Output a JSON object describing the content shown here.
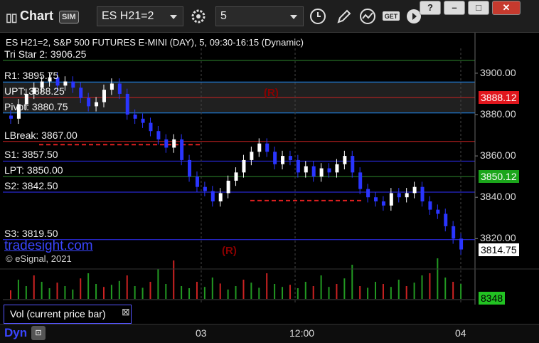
{
  "toolbar": {
    "title": "Chart",
    "sim_badge": "SIM",
    "symbol": "ES H21=2",
    "interval": "5"
  },
  "window": {
    "help_label": "?",
    "minimize_label": "–",
    "maximize_label": "□",
    "close_label": "✕"
  },
  "chart": {
    "header": "ES H21=2, S&P 500 FUTURES E-MINI (DAY), 5, 09:30-16:15 (Dynamic)",
    "watermark": "tradesight.com",
    "copyright": "© eSignal, 2021",
    "r_marks": [
      "(R)",
      "(R)"
    ],
    "levels": [
      {
        "label": "Tri Star 2: 3906.25",
        "value": 3906.25,
        "color": "#2e8b2e"
      },
      {
        "label": "R1: 3895.75",
        "value": 3895.75,
        "color": "#1e90ff"
      },
      {
        "label": "UPT: 3888.25",
        "value": 3888.25,
        "color": "#cc2222"
      },
      {
        "label": "Pivot: 3880.75",
        "value": 3880.75,
        "color": "#1e90ff"
      },
      {
        "label": "LBreak: 3867.00",
        "value": 3867.0,
        "color": "#cc2222"
      },
      {
        "label": "S1: 3857.50",
        "value": 3857.5,
        "color": "#3030ff"
      },
      {
        "label": "LPT: 3850.00",
        "value": 3850.0,
        "color": "#2e8b2e"
      },
      {
        "label": "S2: 3842.50",
        "value": 3842.5,
        "color": "#3030ff"
      },
      {
        "label": "S3: 3819.50",
        "value": 3819.5,
        "color": "#3030ff"
      }
    ],
    "price_axis": [
      "3900.00",
      "3880.00",
      "3860.00",
      "3840.00",
      "3820.00"
    ],
    "price_tags": {
      "upt": "3888.12",
      "lpt": "3850.12",
      "last": "3814.75",
      "volume": "8348"
    },
    "time_axis": [
      "03",
      "12:00",
      "04"
    ],
    "colors": {
      "up": "#ffffff",
      "down": "#2a35ff",
      "upt_tag": "#e0161d",
      "lpt_tag": "#1ba51b"
    }
  },
  "chart_data": {
    "type": "candlestick",
    "symbol": "ES H21=2",
    "y_range": [
      3806,
      3912
    ],
    "closes": [
      3878,
      3885,
      3890,
      3893,
      3896,
      3898,
      3894,
      3896,
      3893,
      3888,
      3884,
      3886,
      3892,
      3895,
      3890,
      3880,
      3878,
      3876,
      3872,
      3868,
      3864,
      3868,
      3858,
      3850,
      3845,
      3843,
      3838,
      3842,
      3848,
      3852,
      3858,
      3862,
      3866,
      3862,
      3856,
      3860,
      3858,
      3852,
      3855,
      3850,
      3854,
      3852,
      3856,
      3860,
      3852,
      3844,
      3840,
      3838,
      3836,
      3842,
      3840,
      3842,
      3845,
      3838,
      3834,
      3832,
      3826,
      3820,
      3814.75
    ],
    "volume_last": 8348,
    "x_ticks": [
      "03",
      "12:00",
      "04"
    ]
  }
}
